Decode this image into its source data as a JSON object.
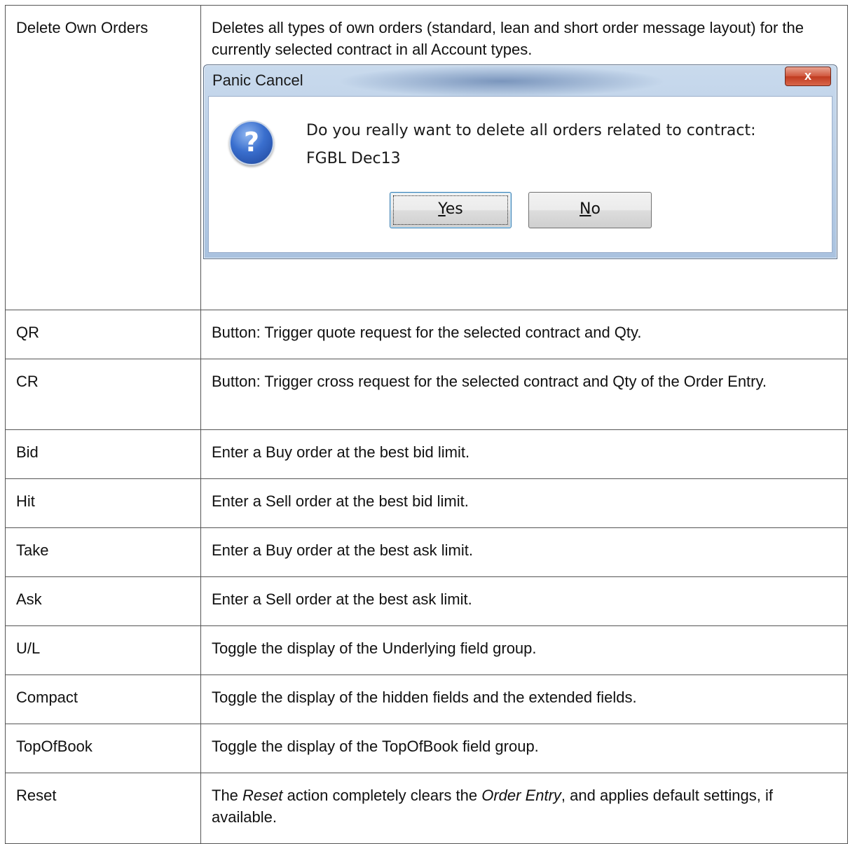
{
  "rows": [
    {
      "label": "Delete Own Orders",
      "text": "Deletes all types of own orders (standard, lean and short order message layout) for the currently selected contract in all Account types."
    },
    {
      "label": "QR",
      "text": "Button: Trigger quote request for the selected contract and Qty."
    },
    {
      "label": "CR",
      "text": "Button: Trigger cross request for the selected contract and Qty of the Order Entry."
    },
    {
      "label": "Bid",
      "text": "Enter a Buy order at the best bid limit."
    },
    {
      "label": "Hit",
      "text": "Enter a Sell order at the best bid limit."
    },
    {
      "label": "Take",
      "text": "Enter a Buy order at the best ask limit."
    },
    {
      "label": "Ask",
      "text": "Enter a Sell order at the best ask limit."
    },
    {
      "label": "U/L",
      "text": "Toggle the display of the Underlying field group."
    },
    {
      "label": "Compact",
      "text": "Toggle the display of the hidden fields and the extended fields."
    },
    {
      "label": "TopOfBook",
      "text": "Toggle the display of the TopOfBook field group."
    },
    {
      "label": "Reset",
      "text_parts": [
        "The ",
        "Reset",
        " action completely clears the ",
        "Order Entry",
        ", and applies default settings, if available."
      ]
    }
  ],
  "dialog": {
    "title": "Panic Cancel",
    "close_glyph": "x",
    "icon": "question-icon",
    "icon_glyph": "?",
    "message": "Do you really want to delete all orders related to contract:",
    "contract": "FGBL Dec13",
    "yes_accel": "Y",
    "yes_rest": "es",
    "no_accel": "N",
    "no_rest": "o"
  }
}
